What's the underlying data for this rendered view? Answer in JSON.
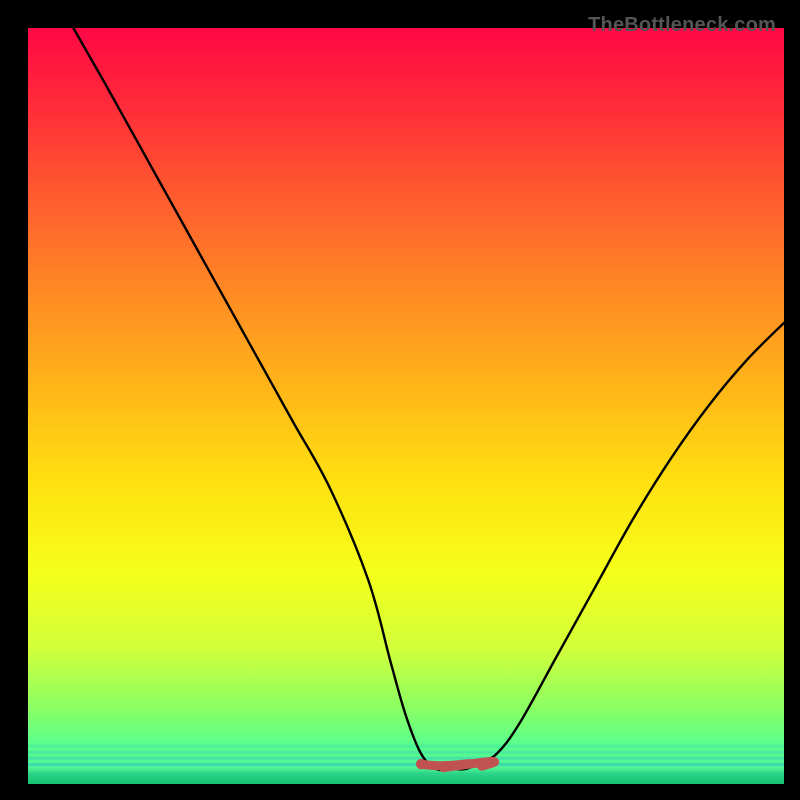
{
  "watermark": "TheBottleneck.com",
  "gradient": {
    "stops": [
      {
        "pos": 0.0,
        "color": "#ff0846"
      },
      {
        "pos": 0.1,
        "color": "#ff2a3a"
      },
      {
        "pos": 0.22,
        "color": "#ff5a2f"
      },
      {
        "pos": 0.35,
        "color": "#ff8a24"
      },
      {
        "pos": 0.48,
        "color": "#ffb718"
      },
      {
        "pos": 0.6,
        "color": "#ffe010"
      },
      {
        "pos": 0.72,
        "color": "#f5ff1a"
      },
      {
        "pos": 0.82,
        "color": "#d2ff3a"
      },
      {
        "pos": 0.9,
        "color": "#8aff63"
      },
      {
        "pos": 0.946,
        "color": "#5cff8c"
      },
      {
        "pos": 0.95,
        "color": "#49f09b"
      },
      {
        "pos": 0.954,
        "color": "#5cff8c"
      },
      {
        "pos": 0.958,
        "color": "#46e6a0"
      },
      {
        "pos": 0.962,
        "color": "#5cff8c"
      },
      {
        "pos": 0.966,
        "color": "#3fddaa"
      },
      {
        "pos": 0.97,
        "color": "#5aff90"
      },
      {
        "pos": 0.974,
        "color": "#36d2b0"
      },
      {
        "pos": 0.978,
        "color": "#53f896"
      },
      {
        "pos": 0.986,
        "color": "#2cd488"
      },
      {
        "pos": 1.0,
        "color": "#15c36f"
      }
    ]
  },
  "chart_data": {
    "type": "line",
    "title": "",
    "xlabel": "",
    "ylabel": "",
    "xlim": [
      0,
      100
    ],
    "ylim": [
      0,
      100
    ],
    "x": [
      6,
      10,
      15,
      20,
      25,
      30,
      35,
      40,
      45,
      48,
      50,
      52,
      54,
      56,
      58,
      60,
      62,
      65,
      70,
      75,
      80,
      85,
      90,
      95,
      100
    ],
    "values": [
      100,
      93,
      84,
      75,
      66,
      57,
      48,
      39,
      27,
      16,
      9,
      4,
      2,
      2,
      2,
      3,
      4,
      8,
      17,
      26,
      35,
      43,
      50,
      56,
      61
    ],
    "flat_segment": {
      "x_start": 52,
      "x_end": 60,
      "y": 2.5,
      "color": "#c05252"
    }
  }
}
